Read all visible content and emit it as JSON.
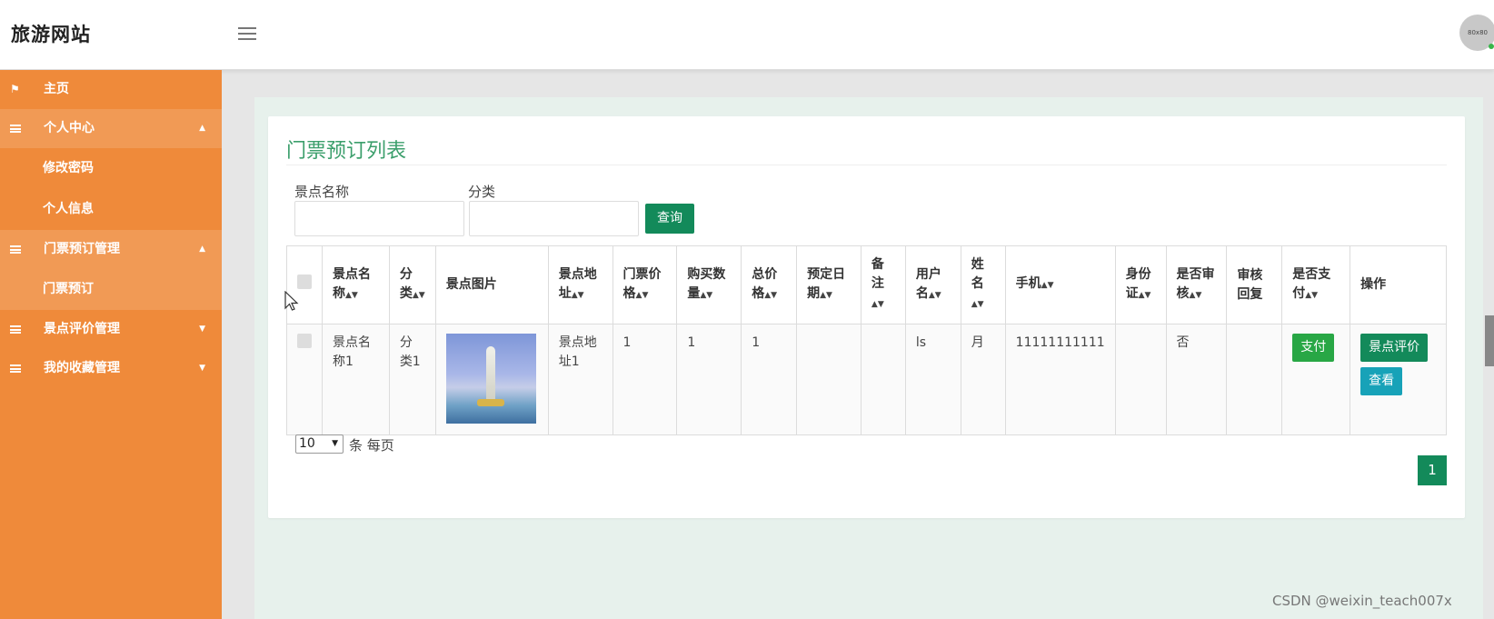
{
  "header": {
    "brand": "旅游网站",
    "avatar_text": "80x80"
  },
  "sidebar": {
    "items": [
      {
        "label": "主页"
      },
      {
        "label": "个人中心"
      },
      {
        "label": "修改密码"
      },
      {
        "label": "个人信息"
      },
      {
        "label": "门票预订管理"
      },
      {
        "label": "门票预订"
      },
      {
        "label": "景点评价管理"
      },
      {
        "label": "我的收藏管理"
      }
    ]
  },
  "main": {
    "title": "门票预订列表",
    "filters": {
      "name_label": "景点名称",
      "category_label": "分类",
      "name_value": "",
      "category_value": "",
      "query_button": "查询"
    },
    "table": {
      "headers": [
        "景点名称",
        "分类",
        "景点图片",
        "景点地址",
        "门票价格",
        "购买数量",
        "总价格",
        "预定日期",
        "备注",
        "用户名",
        "姓名",
        "手机",
        "身份证",
        "是否审核",
        "审核回复",
        "是否支付",
        "操作"
      ],
      "rows": [
        {
          "name": "景点名称1",
          "category": "分类1",
          "address": "景点地址1",
          "price": "1",
          "quantity": "1",
          "total": "1",
          "date": "",
          "remark": "",
          "username": "ls",
          "realname": "月",
          "phone": "11111111111",
          "idcard": "",
          "reviewed": "否",
          "reply": "",
          "pay_button": "支付",
          "review_button": "景点评价",
          "view_button": "查看"
        }
      ]
    },
    "pagination": {
      "page_size": "10",
      "page_size_suffix": "条 每页",
      "current_page": "1"
    }
  },
  "watermark": "CSDN @weixin_teach007x",
  "colors": {
    "sidebar": "#ef8a3a",
    "accent": "#138a5a",
    "title": "#3c9f6c"
  }
}
